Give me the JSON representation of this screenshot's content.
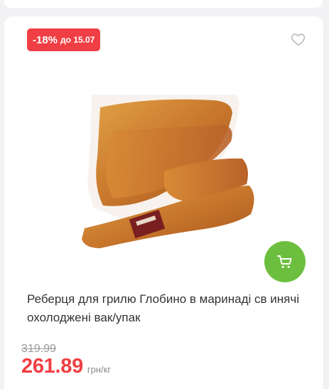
{
  "badge": {
    "discount": "-18%",
    "until": "до 15.07",
    "color": "#ef3f44"
  },
  "icons": {
    "favorite": "heart-outline-icon",
    "cart": "cart-icon"
  },
  "product": {
    "title": "Реберця для грилю Глобино в маринаді св инячі охолоджені вак/упак",
    "old_price": "319.99",
    "price": "261.89",
    "unit": "грн/кг"
  },
  "colors": {
    "accent_red": "#ef3f44",
    "cart_green": "#6cbf3e"
  }
}
